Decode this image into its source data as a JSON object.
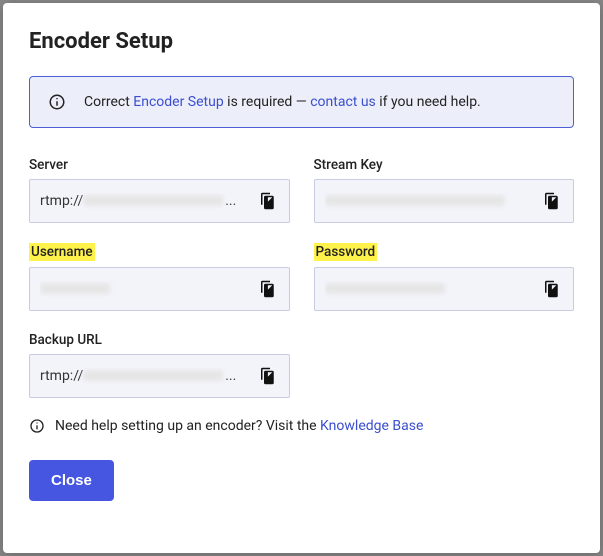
{
  "title": "Encoder Setup",
  "banner": {
    "pre": "Correct ",
    "link1": "Encoder Setup",
    "mid": " is required — ",
    "link2": "contact us",
    "post": " if you need help."
  },
  "fields": {
    "server": {
      "label": "Server",
      "prefix": "rtmp://",
      "truncated": true
    },
    "stream_key": {
      "label": "Stream Key"
    },
    "username": {
      "label": "Username"
    },
    "password": {
      "label": "Password"
    },
    "backup_url": {
      "label": "Backup URL",
      "prefix": "rtmp://",
      "truncated": true
    }
  },
  "help": {
    "pre": "Need help setting up an encoder? Visit the ",
    "link": "Knowledge Base"
  },
  "close": "Close"
}
